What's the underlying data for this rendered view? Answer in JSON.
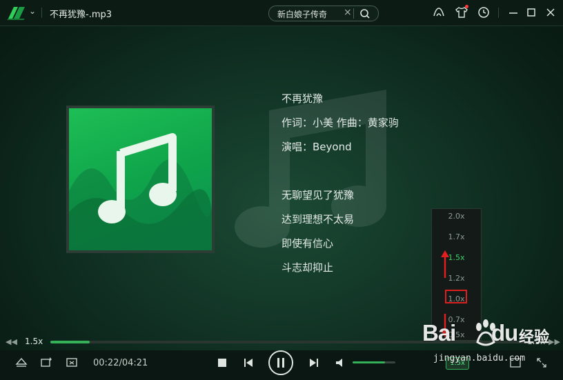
{
  "window": {
    "file_title": "不再犹豫-.mp3",
    "search_value": "新白娘子传奇",
    "search_clear": "×"
  },
  "lyrics": {
    "lines": [
      "不再犹豫",
      "作词：小美 作曲：黄家驹",
      "演唱：Beyond",
      "无聊望见了犹豫",
      "达到理想不太易",
      "即使有信心",
      "斗志却抑止"
    ]
  },
  "speed_menu": {
    "options": [
      "2.0x",
      "1.7x",
      "1.5x",
      "1.2x",
      "1.0x",
      "0.7x",
      "0.5x"
    ],
    "highlighted": "1.5x",
    "boxed": "1.0x",
    "colors": {
      "highlight": "#3fd167",
      "box": "#e02020",
      "arrow": "#e02020"
    }
  },
  "progress": {
    "speed_left": "1.5x",
    "speed_right": "1.5x",
    "played_fraction": 0.083
  },
  "controls": {
    "time": "00:22/04:21",
    "volume_fraction": 0.75,
    "speed_toggle": "1.5x"
  },
  "watermark": {
    "brand": "Bai",
    "brand_suffix": "du",
    "cn": "经验",
    "url": "jingyan.baidu.com"
  },
  "theme": {
    "accent": "#35b15a",
    "background": "#0f2a1e"
  }
}
